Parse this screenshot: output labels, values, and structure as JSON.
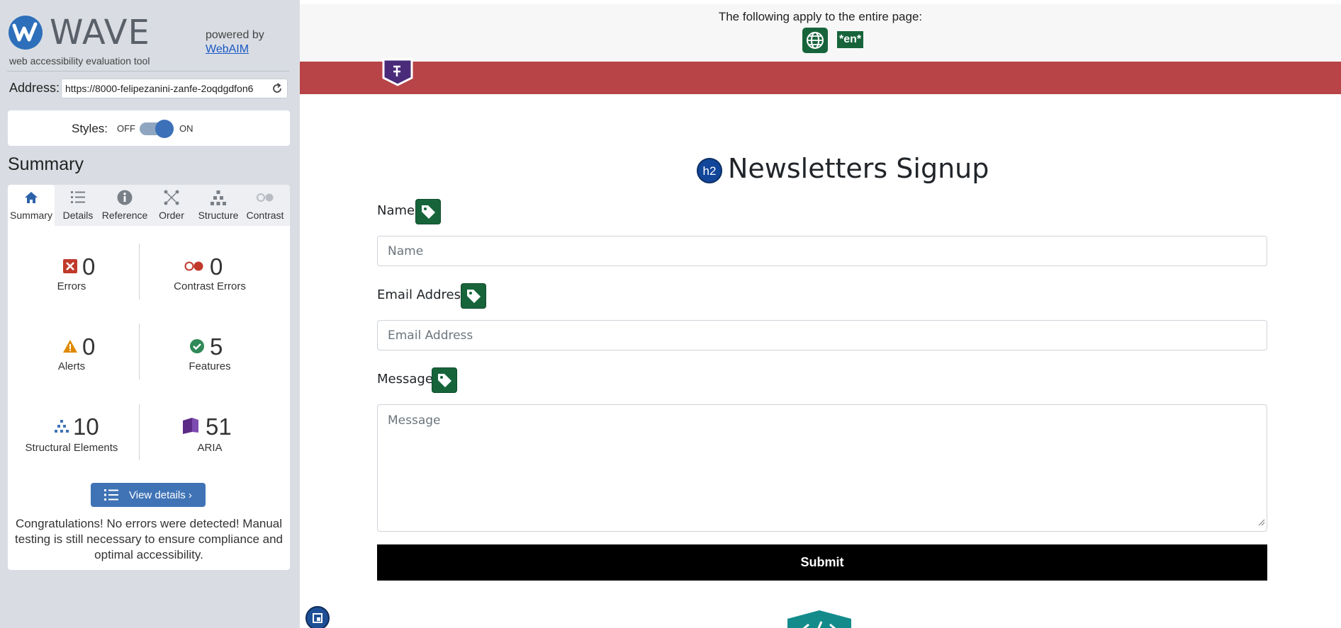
{
  "wave": {
    "logo_text": "WAVE",
    "tagline": "web accessibility evaluation tool",
    "powered_by": "powered by",
    "webaim_link": "WebAIM",
    "address_label": "Address:",
    "address_value": "https://8000-felipezanini-zanfe-2oqdgdfon6",
    "styles_label": "Styles:",
    "styles_off": "OFF",
    "styles_on": "ON",
    "styles_enabled": true,
    "summary_heading": "Summary",
    "tabs": [
      {
        "label": "Summary",
        "icon": "home-icon",
        "active": true
      },
      {
        "label": "Details",
        "icon": "list-icon",
        "active": false
      },
      {
        "label": "Reference",
        "icon": "info-icon",
        "active": false
      },
      {
        "label": "Order",
        "icon": "order-icon",
        "active": false
      },
      {
        "label": "Structure",
        "icon": "structure-icon",
        "active": false
      },
      {
        "label": "Contrast",
        "icon": "contrast-icon",
        "active": false
      }
    ],
    "stats": {
      "errors": {
        "value": "0",
        "label": "Errors"
      },
      "contrast_errors": {
        "value": "0",
        "label": "Contrast Errors"
      },
      "alerts": {
        "value": "0",
        "label": "Alerts"
      },
      "features": {
        "value": "5",
        "label": "Features"
      },
      "structural": {
        "value": "10",
        "label": "Structural Elements"
      },
      "aria": {
        "value": "51",
        "label": "ARIA"
      }
    },
    "view_details": "View details ›",
    "congrats": "Congratulations! No errors were detected! Manual testing is still necessary to ensure compliance and optimal accessibility."
  },
  "page": {
    "apply_text": "The following apply to the entire page:",
    "lang_badge": "*en*",
    "h2_badge": "h2",
    "title": "Newsletters Signup",
    "fields": {
      "name_label": "Name",
      "name_placeholder": "Name",
      "email_label": "Email Address",
      "email_placeholder": "Email Address",
      "message_label": "Message",
      "message_placeholder": "Message"
    },
    "submit": "Submit"
  },
  "colors": {
    "accent": "#3f73b6",
    "red_band": "#b84447",
    "wave_green": "#17643b",
    "error_red": "#c0392b",
    "alert_orange": "#e08a00",
    "feature_green": "#2f8a58",
    "aria_purple": "#5b2a86"
  }
}
